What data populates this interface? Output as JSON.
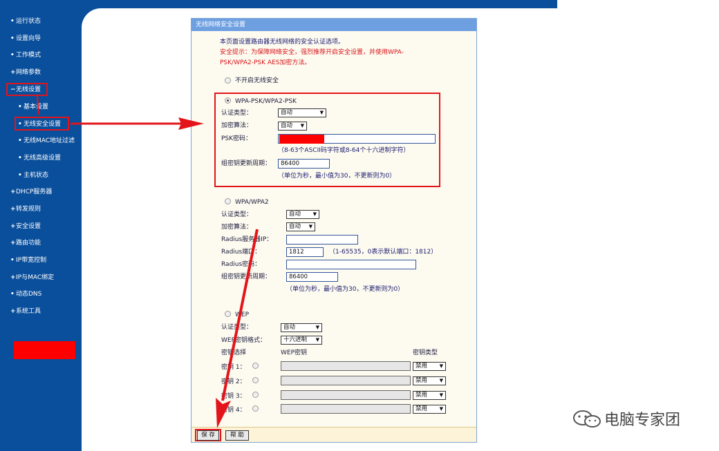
{
  "sidebar": {
    "items": [
      {
        "bullet": "•",
        "label": "运行状态"
      },
      {
        "bullet": "•",
        "label": "设置向导"
      },
      {
        "bullet": "•",
        "label": "工作模式"
      },
      {
        "bullet": "+",
        "label": "网络参数"
      },
      {
        "bullet": "−",
        "label": "无线设置"
      },
      {
        "bullet": "•",
        "label": "基本设置"
      },
      {
        "bullet": "•",
        "label": "无线安全设置"
      },
      {
        "bullet": "•",
        "label": "无线MAC地址过滤"
      },
      {
        "bullet": "•",
        "label": "无线高级设置"
      },
      {
        "bullet": "•",
        "label": "主机状态"
      },
      {
        "bullet": "+",
        "label": "DHCP服务器"
      },
      {
        "bullet": "+",
        "label": "转发规则"
      },
      {
        "bullet": "+",
        "label": "安全设置"
      },
      {
        "bullet": "+",
        "label": "路由功能"
      },
      {
        "bullet": "•",
        "label": "IP带宽控制"
      },
      {
        "bullet": "+",
        "label": "IP与MAC绑定"
      },
      {
        "bullet": "•",
        "label": "动态DNS"
      },
      {
        "bullet": "+",
        "label": "系统工具"
      }
    ]
  },
  "panel": {
    "title": "无线网络安全设置",
    "intro": "本页面设置路由器无线网络的安全认证选项。",
    "warning_line1": "安全提示：为保障网络安全，强烈推荐开启安全设置，并使用WPA-",
    "warning_line2": "PSK/WPA2-PSK AES加密方法。",
    "no_security": "不开启无线安全",
    "wpa_psk": {
      "title": "WPA-PSK/WPA2-PSK",
      "auth_label": "认证类型：",
      "auth_value": "自动",
      "enc_label": "加密算法：",
      "enc_value": "自动",
      "psk_label": "PSK密码：",
      "psk_hint": "（8-63个ASCII码字符或8-64个十六进制字符）",
      "renew_label": "组密钥更新周期：",
      "renew_value": "86400",
      "renew_hint": "（单位为秒，最小值为30，不更新则为0）"
    },
    "wpa": {
      "title": "WPA/WPA2",
      "auth_label": "认证类型：",
      "auth_value": "自动",
      "enc_label": "加密算法：",
      "enc_value": "自动",
      "radius_ip_label": "Radius服务器IP：",
      "radius_port_label": "Radius端口：",
      "radius_port_value": "1812",
      "radius_port_hint": "（1-65535，0表示默认端口：1812）",
      "radius_pwd_label": "Radius密码：",
      "renew_label": "组密钥更新周期：",
      "renew_value": "86400",
      "renew_hint": "（单位为秒，最小值为30，不更新则为0）"
    },
    "wep": {
      "title": "WEP",
      "auth_label": "认证类型：",
      "auth_value": "自动",
      "format_label": "WEP密钥格式：",
      "format_value": "十六进制",
      "col_key_select": "密钥选择",
      "col_key": "WEP密钥",
      "col_key_type": "密钥类型",
      "keys": [
        {
          "label": "密钥 1：",
          "type": "禁用"
        },
        {
          "label": "密钥 2：",
          "type": "禁用"
        },
        {
          "label": "密钥 3：",
          "type": "禁用"
        },
        {
          "label": "密钥 4：",
          "type": "禁用"
        }
      ]
    },
    "save_label": "保 存",
    "help_label": "帮 助"
  },
  "watermark": {
    "text": "电脑专家团"
  },
  "colors": {
    "sidebar": "#0a4f9c",
    "highlight": "#e3141a",
    "panel_title": "#6e9fe0"
  }
}
